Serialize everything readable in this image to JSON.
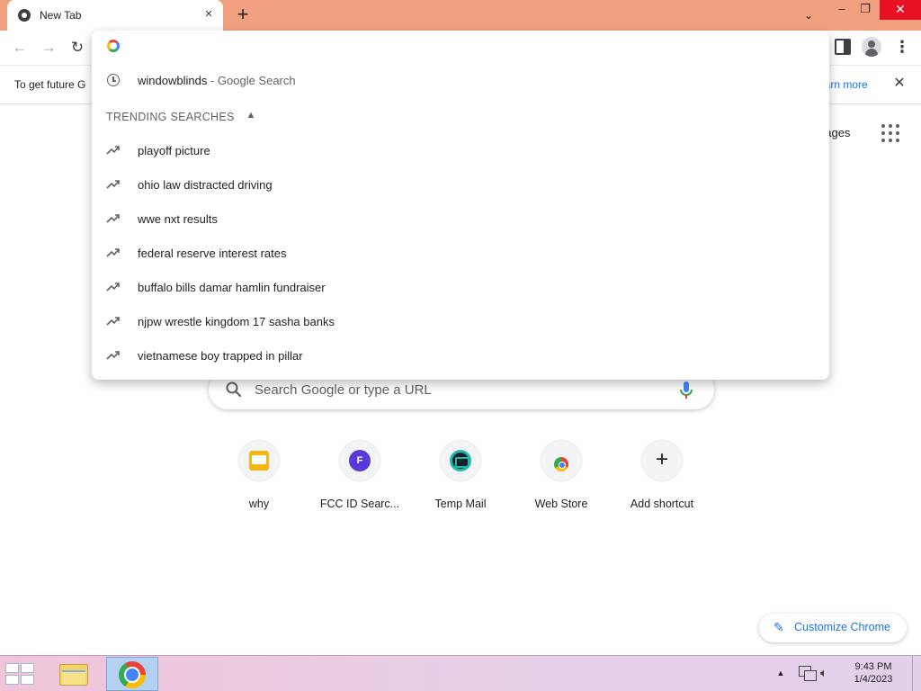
{
  "tab": {
    "title": "New Tab"
  },
  "window_controls": {
    "minimize": "–",
    "maximize": "❐",
    "close": "✕"
  },
  "toolbar": {
    "back": "←",
    "forward": "→",
    "reload": "↻",
    "menu": "⋮"
  },
  "infobar": {
    "text": "To get future G",
    "link": "earn more",
    "close": "✕"
  },
  "omnibox": {
    "input_value": "",
    "history": [
      {
        "query": "windowblinds",
        "separator": " - ",
        "suffix": "Google Search",
        "icon": "history-icon"
      }
    ],
    "trending_header": "TRENDING SEARCHES",
    "trending": [
      {
        "text": "playoff picture",
        "icon": "trending-icon"
      },
      {
        "text": "ohio law distracted driving",
        "icon": "trending-icon"
      },
      {
        "text": "wwe nxt results",
        "icon": "trending-icon"
      },
      {
        "text": "federal reserve interest rates",
        "icon": "trending-icon"
      },
      {
        "text": "buffalo bills damar hamlin fundraiser",
        "icon": "trending-icon"
      },
      {
        "text": "njpw wrestle kingdom 17 sasha banks",
        "icon": "trending-icon"
      },
      {
        "text": "vietnamese boy trapped in pillar",
        "icon": "trending-icon"
      }
    ]
  },
  "ntp": {
    "images_link": "nages",
    "search_placeholder": "Search Google or type a URL",
    "shortcuts": [
      {
        "label": "why",
        "icon": "why-favicon"
      },
      {
        "label": "FCC ID Searc...",
        "icon": "fcc-favicon",
        "glyph": "F"
      },
      {
        "label": "Temp Mail",
        "icon": "temp-mail-favicon"
      },
      {
        "label": "Web Store",
        "icon": "web-store-favicon"
      },
      {
        "label": "Add shortcut",
        "icon": "plus-icon",
        "glyph": "+"
      }
    ],
    "customize_label": "Customize Chrome"
  },
  "taskbar": {
    "clock_time": "9:43 PM",
    "clock_date": "1/4/2023"
  },
  "colors": {
    "titlebar": "#f1a17f",
    "accent": "#1a73e8",
    "close_button": "#e81123"
  }
}
